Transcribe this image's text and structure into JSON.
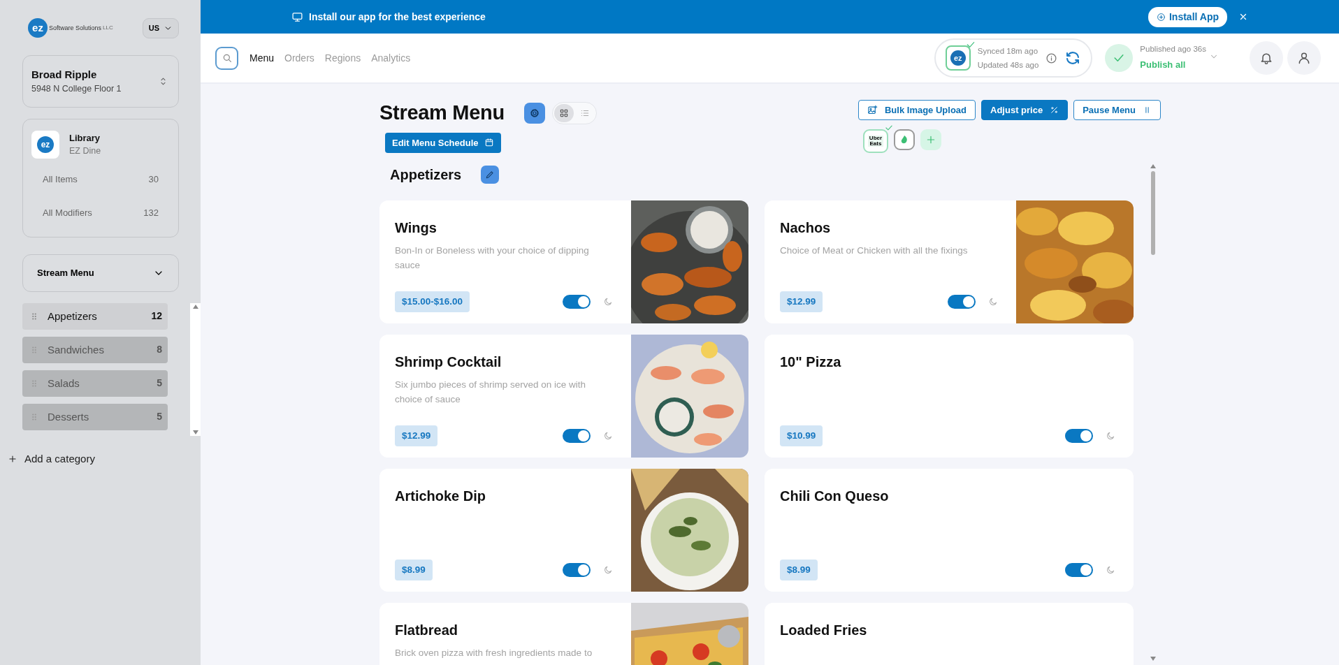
{
  "banner": {
    "message": "Install our app for the best experience",
    "install_button": "Install App"
  },
  "sidebar": {
    "logo": {
      "mark": "ez",
      "name": "Software Solutions",
      "suffix": "LLC"
    },
    "region": "US",
    "location": {
      "name": "Broad Ripple",
      "address": "5948 N College Floor 1"
    },
    "library": {
      "mark": "ez",
      "title": "Library",
      "subtitle": "EZ Dine",
      "rows": [
        {
          "label": "All Items",
          "count": "30"
        },
        {
          "label": "All Modifiers",
          "count": "132"
        }
      ]
    },
    "menu_select": "Stream Menu",
    "categories": [
      {
        "name": "Appetizers",
        "count": "12",
        "selected": true
      },
      {
        "name": "Sandwiches",
        "count": "8",
        "selected": false
      },
      {
        "name": "Salads",
        "count": "5",
        "selected": false
      },
      {
        "name": "Desserts",
        "count": "5",
        "selected": false
      }
    ],
    "add_category": "Add a category"
  },
  "nav": {
    "items": [
      {
        "label": "Menu",
        "selected": true
      },
      {
        "label": "Orders",
        "selected": false
      },
      {
        "label": "Regions",
        "selected": false
      },
      {
        "label": "Analytics",
        "selected": false
      }
    ]
  },
  "sync": {
    "mark": "ez",
    "synced": "Synced 18m ago",
    "updated": "Updated 48s ago"
  },
  "publish": {
    "status": "Published ago 36s",
    "action": "Publish all"
  },
  "toolbar": {
    "title": "Stream Menu",
    "views": [
      {
        "kind": "grid",
        "selected": true
      },
      {
        "kind": "list",
        "selected": false
      }
    ],
    "schedule_button": "Edit Menu Schedule",
    "actions": [
      {
        "label": "Bulk Image Upload",
        "primary": false
      },
      {
        "label": "Adjust price",
        "primary": true
      },
      {
        "label": "Pause Menu",
        "primary": false
      }
    ],
    "channels": [
      {
        "kind": "logo",
        "text": "Uber Eats",
        "connected": true
      },
      {
        "kind": "app",
        "connected": false
      },
      {
        "kind": "add"
      }
    ]
  },
  "section": {
    "title": "Appetizers"
  },
  "items": [
    {
      "name": "Wings",
      "description": "Bon-In or Boneless with your choice of dipping sauce",
      "price": "$15.00-$16.00",
      "available": true
    },
    {
      "name": "Nachos",
      "description": "Choice of Meat or Chicken with all the fixings",
      "price": "$12.99",
      "available": true
    },
    {
      "name": "Shrimp Cocktail",
      "description": "Six jumbo pieces of shrimp served on ice with choice of sauce",
      "price": "$12.99",
      "available": true
    },
    {
      "name": "10\" Pizza",
      "price": "$10.99",
      "available": true
    },
    {
      "name": "Artichoke Dip",
      "price": "$8.99",
      "available": true
    },
    {
      "name": "Chili Con Queso",
      "price": "$8.99",
      "available": true
    },
    {
      "name": "Flatbread",
      "description": "Brick oven pizza with fresh ingredients made to"
    },
    {
      "name": "Loaded Fries"
    }
  ]
}
